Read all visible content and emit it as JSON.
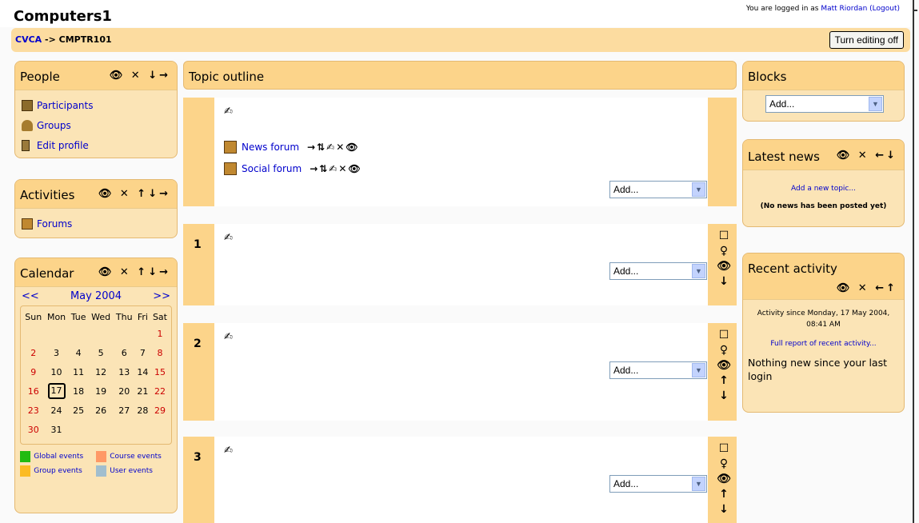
{
  "header": {
    "site_title": "Computers1",
    "login_prefix": "You are logged in as ",
    "user_name": "Matt Riordan",
    "logout": "(Logout)"
  },
  "navbar": {
    "crumb_home": "CVCA",
    "crumb_sep": " -> ",
    "crumb_course": "CMPTR101",
    "edit_button": "Turn editing off"
  },
  "people": {
    "title": "People",
    "controls": "👁 ✕ ↓→",
    "items": [
      "Participants",
      "Groups",
      "Edit profile"
    ]
  },
  "activities": {
    "title": "Activities",
    "controls": "👁 ✕ ↑↓→",
    "items": [
      "Forums"
    ]
  },
  "calendar": {
    "title": "Calendar",
    "controls": "👁 ✕ ↑↓→",
    "prev": "<<",
    "month": "May 2004",
    "next": ">>",
    "days": [
      "Sun",
      "Mon",
      "Tue",
      "Wed",
      "Thu",
      "Fri",
      "Sat"
    ],
    "today": "17",
    "legend": {
      "global": "Global events",
      "course": "Course events",
      "group": "Group events",
      "user": "User events"
    },
    "colors": {
      "global": "#22bb11",
      "course": "#ff9966",
      "group": "#fbbb23",
      "user": "#a1bece",
      "weekend": "#cc0000"
    }
  },
  "main": {
    "title": "Topic outline",
    "add_label": "Add...",
    "edit_icon": "✍",
    "forums": [
      {
        "name": "News forum",
        "controls": "→⇅✍✕👁"
      },
      {
        "name": "Social forum",
        "controls": "→⇅✍✕👁"
      }
    ],
    "help_icon": "?",
    "sections": [
      "1",
      "2",
      "3"
    ]
  },
  "blocks_block": {
    "title": "Blocks",
    "add_label": "Add..."
  },
  "news": {
    "title": "Latest news",
    "controls": "👁 ✕ ←↓",
    "add_topic": "Add a new topic...",
    "empty": "(No news has been posted yet)"
  },
  "recent": {
    "title": "Recent activity",
    "controls": "👁 ✕ ←↑",
    "since": "Activity since Monday, 17 May 2004, 08:41 AM",
    "full_report": "Full report of recent activity...",
    "nothing": "Nothing new since your last login"
  }
}
